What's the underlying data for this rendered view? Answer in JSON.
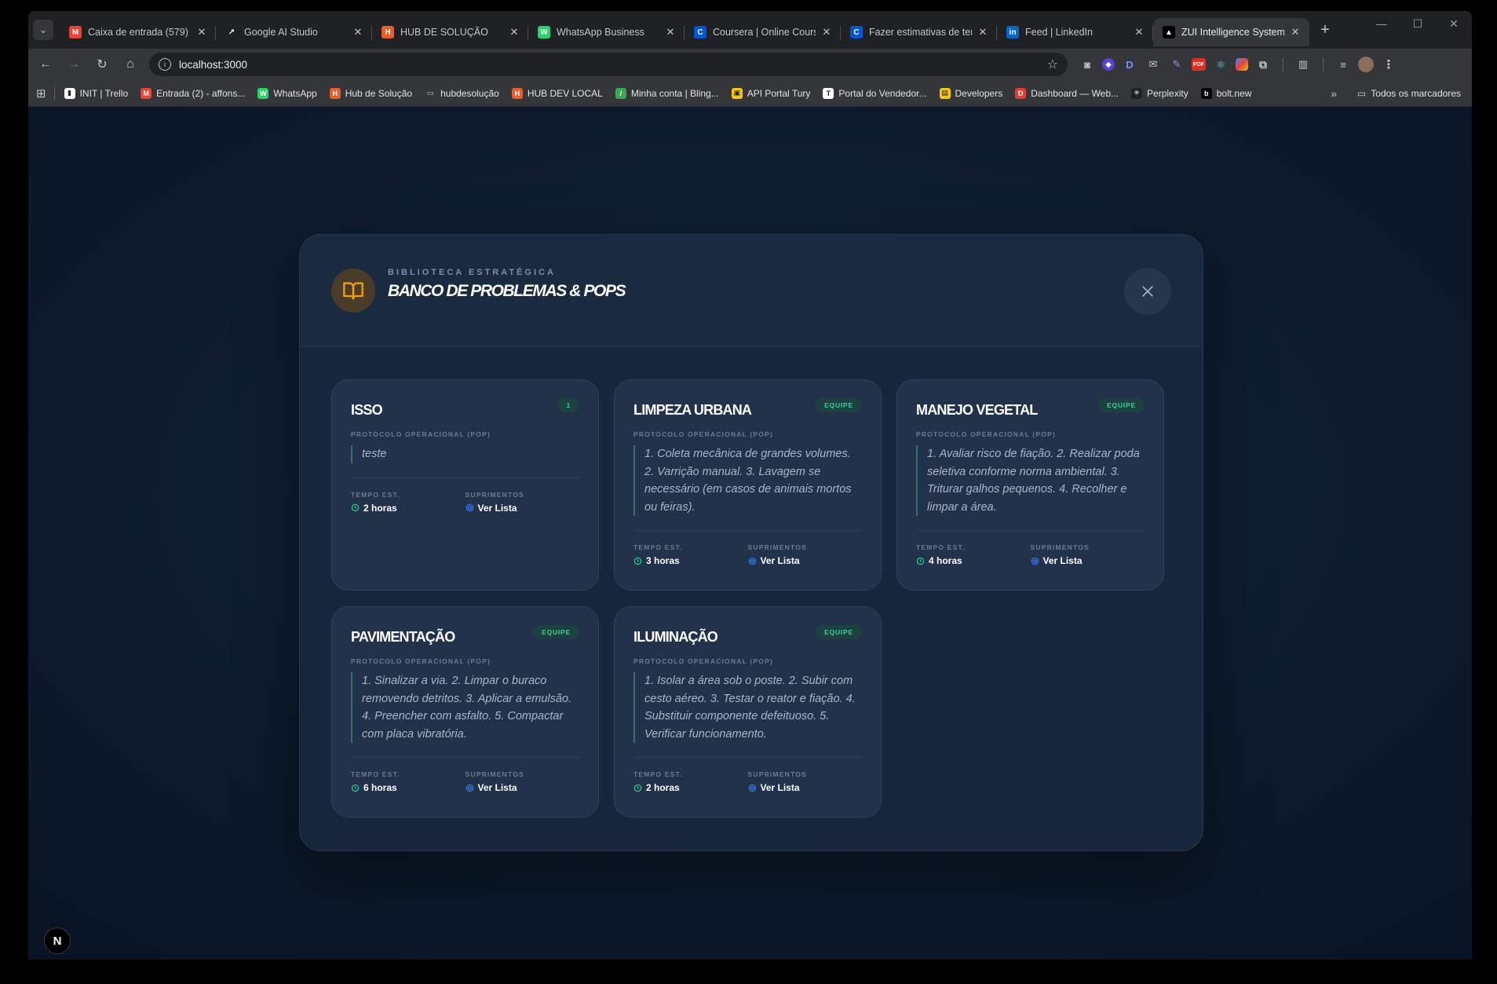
{
  "browser": {
    "tabs": [
      {
        "title": "Caixa de entrada (579) - ",
        "icon": "gmail-icon",
        "color": "#ea4335",
        "glyph": "M"
      },
      {
        "title": "Google AI Studio",
        "icon": "ai-studio-icon",
        "color": "#202124",
        "glyph": "↗"
      },
      {
        "title": "HUB DE SOLUÇÃO",
        "icon": "hub-icon",
        "color": "#e85d2a",
        "glyph": "H"
      },
      {
        "title": "WhatsApp Business",
        "icon": "whatsapp-icon",
        "color": "#25d366",
        "glyph": "W"
      },
      {
        "title": "Coursera | Online Cours",
        "icon": "coursera-icon",
        "color": "#0056d2",
        "glyph": "C"
      },
      {
        "title": "Fazer estimativas de ter",
        "icon": "coursera-icon",
        "color": "#0056d2",
        "glyph": "C"
      },
      {
        "title": "Feed | LinkedIn",
        "icon": "linkedin-icon",
        "color": "#0a66c2",
        "glyph": "in"
      },
      {
        "title": "ZUI Intelligence System",
        "icon": "vercel-icon",
        "color": "#000000",
        "glyph": "▲",
        "active": true
      }
    ],
    "url": "localhost:3000",
    "bookmarks": [
      {
        "label": "INIT | Trello",
        "icon": "trello-icon",
        "color": "#ffffff",
        "glyph": "▮"
      },
      {
        "label": "Entrada (2) - affons...",
        "icon": "gmail-icon",
        "color": "#ea4335",
        "glyph": "M"
      },
      {
        "label": "WhatsApp",
        "icon": "whatsapp-icon",
        "color": "#25d366",
        "glyph": "W"
      },
      {
        "label": "Hub de Solução",
        "icon": "hub-icon",
        "color": "#e85d2a",
        "glyph": "H"
      },
      {
        "label": "hubdesolução",
        "icon": "folder-icon",
        "color": "transparent",
        "glyph": "▭"
      },
      {
        "label": "HUB DEV LOCAL",
        "icon": "hub-icon",
        "color": "#e85d2a",
        "glyph": "H"
      },
      {
        "label": "Minha conta | Bling...",
        "icon": "bling-icon",
        "color": "#3aa655",
        "glyph": "/"
      },
      {
        "label": "API Portal Tury",
        "icon": "tury-icon",
        "color": "#f5c518",
        "glyph": "▣"
      },
      {
        "label": "Portal do Vendedor...",
        "icon": "tury-portal-icon",
        "color": "#ffffff",
        "glyph": "T"
      },
      {
        "label": "Developers",
        "icon": "developers-icon",
        "color": "#f5c518",
        "glyph": "▤"
      },
      {
        "label": "Dashboard — Web...",
        "icon": "dashboard-icon",
        "color": "#e53935",
        "glyph": "D"
      },
      {
        "label": "Perplexity",
        "icon": "perplexity-icon",
        "color": "#202124",
        "glyph": "✳"
      },
      {
        "label": "bolt.new",
        "icon": "bolt-icon",
        "color": "#000000",
        "glyph": "b"
      }
    ],
    "all_bookmarks": "Todos os marcadores"
  },
  "modal": {
    "eyebrow": "BIBLIOTECA ESTRATÉGICA",
    "title": "BANCO DE PROBLEMAS & POPS",
    "accent": "#f59e0b",
    "pop_label": "PROTOCOLO OPERACIONAL (POP)",
    "time_label": "TEMPO EST.",
    "supplies_label": "SUPRIMENTOS",
    "cards": [
      {
        "title": "ISSO",
        "badge": "1",
        "pop": "teste",
        "time": "2 horas",
        "supplies": "Ver Lista"
      },
      {
        "title": "LIMPEZA URBANA",
        "badge": "EQUIPE",
        "pop": "1. Coleta mecânica de grandes volumes. 2. Varrição manual. 3. Lavagem se necessário (em casos de animais mortos ou feiras).",
        "time": "3 horas",
        "supplies": "Ver Lista"
      },
      {
        "title": "MANEJO VEGETAL",
        "badge": "EQUIPE",
        "pop": "1. Avaliar risco de fiação. 2. Realizar poda seletiva conforme norma ambiental. 3. Triturar galhos pequenos. 4. Recolher e limpar a área.",
        "time": "4 horas",
        "supplies": "Ver Lista"
      },
      {
        "title": "PAVIMENTAÇÃO",
        "badge": "EQUIPE",
        "pop": "1. Sinalizar a via. 2. Limpar o buraco removendo detritos. 3. Aplicar a emulsão. 4. Preencher com asfalto. 5. Compactar com placa vibratória.",
        "time": "6 horas",
        "supplies": "Ver Lista"
      },
      {
        "title": "ILUMINAÇÃO",
        "badge": "EQUIPE",
        "pop": "1. Isolar a área sob o poste. 2. Subir com cesto aéreo. 3. Testar o reator e fiação. 4. Substituir componente defeituoso. 5. Verificar funcionamento.",
        "time": "2 horas",
        "supplies": "Ver Lista"
      }
    ]
  },
  "dev_badge": "N"
}
